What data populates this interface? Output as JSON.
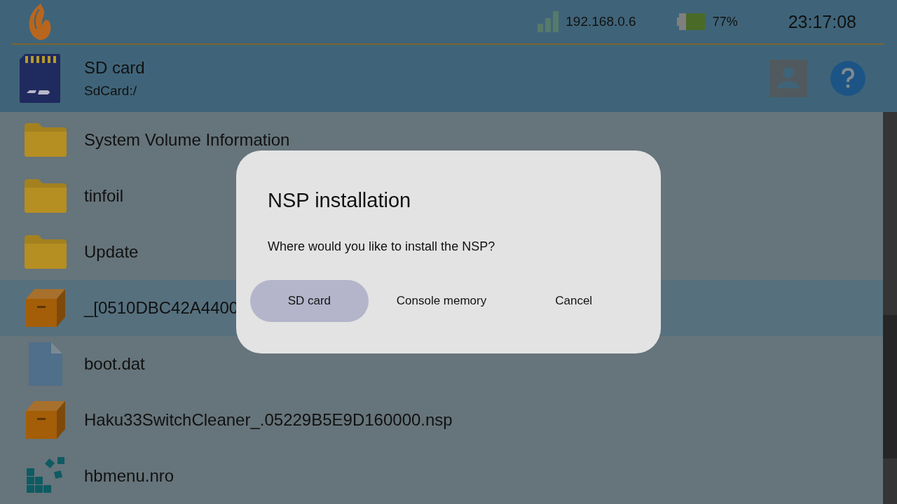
{
  "status_bar": {
    "ip": "192.168.0.6",
    "battery": "77%",
    "time": "23:17:08"
  },
  "location": {
    "title": "SD card",
    "path": "SdCard:/"
  },
  "files": [
    {
      "name": "System Volume Information",
      "kind": "folder",
      "selected": false
    },
    {
      "name": "tinfoil",
      "kind": "folder",
      "selected": false
    },
    {
      "name": "Update",
      "kind": "folder",
      "selected": false
    },
    {
      "name": "_[0510DBC42A4400",
      "kind": "package",
      "selected": true
    },
    {
      "name": "boot.dat",
      "kind": "file",
      "selected": false
    },
    {
      "name": "Haku33SwitchCleaner_.05229B5E9D160000.nsp",
      "kind": "package",
      "selected": false
    },
    {
      "name": "hbmenu.nro",
      "kind": "homebrew",
      "selected": false
    }
  ],
  "dialog": {
    "title": "NSP installation",
    "message": "Where would you like to install the NSP?",
    "buttons": [
      {
        "label": "SD card",
        "selected": true
      },
      {
        "label": "Console memory",
        "selected": false
      },
      {
        "label": "Cancel",
        "selected": false
      }
    ]
  }
}
